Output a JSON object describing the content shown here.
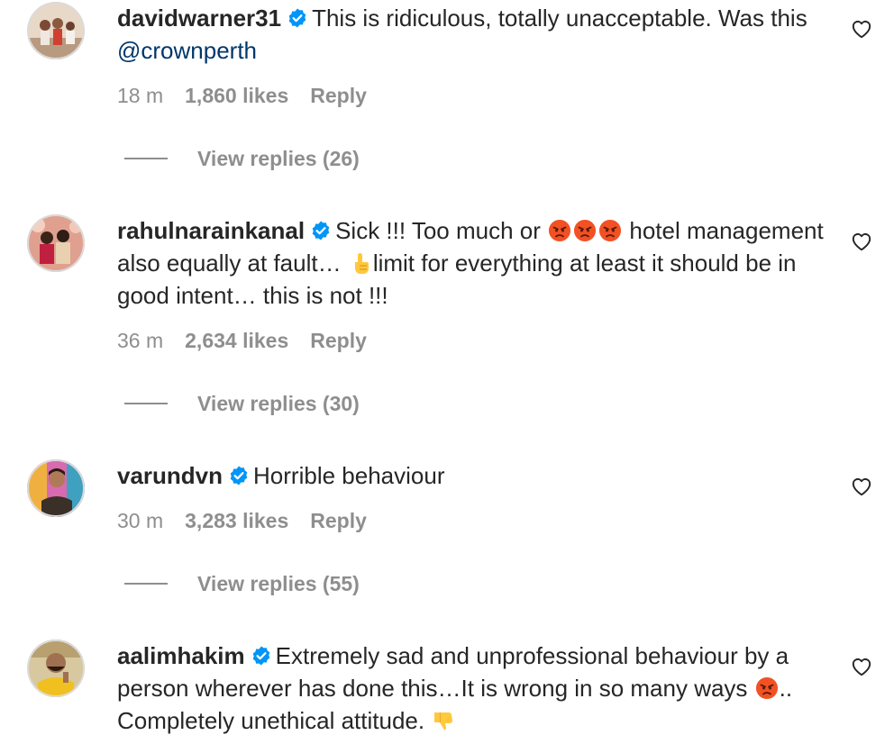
{
  "colors": {
    "text": "#262626",
    "secondary": "#8e8e8e",
    "mention": "#00376b",
    "verified": "#0095f6"
  },
  "comments": [
    {
      "username": "davidwarner31",
      "verified": true,
      "text_part1": "This is ridiculous, totally unacceptable. Was this ",
      "mention": "@crownperth",
      "time": "18 m",
      "likes": "1,860 likes",
      "reply": "Reply",
      "view_replies": "View replies (26)"
    },
    {
      "username": "rahulnarainkanal",
      "verified": true,
      "text_part1": "Sick !!! Too much or ",
      "emoji_1": "angry-face",
      "text_part2": " hotel management also equally at fault… ",
      "emoji_2": "pointing-up-hand",
      "text_part3": "limit for everything at least it should be in good intent… this is not !!!",
      "time": "36 m",
      "likes": "2,634 likes",
      "reply": "Reply",
      "view_replies": "View replies (30)"
    },
    {
      "username": "varundvn",
      "verified": true,
      "text_part1": "Horrible behaviour",
      "time": "30 m",
      "likes": "3,283 likes",
      "reply": "Reply",
      "view_replies": "View replies (55)"
    },
    {
      "username": "aalimhakim",
      "verified": true,
      "text_part1": "Extremely sad and unprofessional behaviour by a person wherever has done this…It is wrong in so many ways ",
      "emoji_1": "angry-face",
      "text_part2": ".. Completely unethical attitude. ",
      "emoji_2": "thumbs-down"
    }
  ]
}
